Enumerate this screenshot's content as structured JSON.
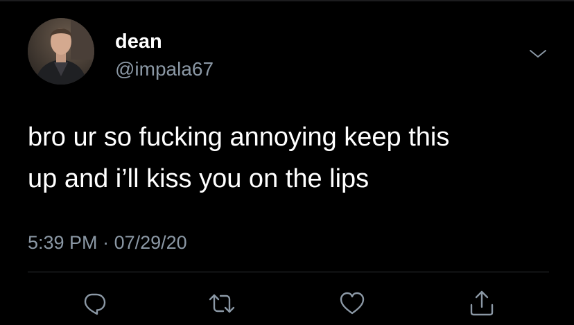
{
  "tweet": {
    "display_name": "dean",
    "handle": "@impala67",
    "text_line1": "bro ur so fucking annoying keep this",
    "text_line2": "up and i’ll kiss you on the lips",
    "time": "5:39 PM",
    "separator": "·",
    "date": "07/29/20"
  },
  "icons": {
    "menu": "chevron-down-icon",
    "reply": "reply-icon",
    "retweet": "retweet-icon",
    "like": "like-icon",
    "share": "share-icon"
  },
  "colors": {
    "background": "#000000",
    "text": "#ffffff",
    "secondary": "#8b98a5",
    "divider": "#2f3336"
  }
}
